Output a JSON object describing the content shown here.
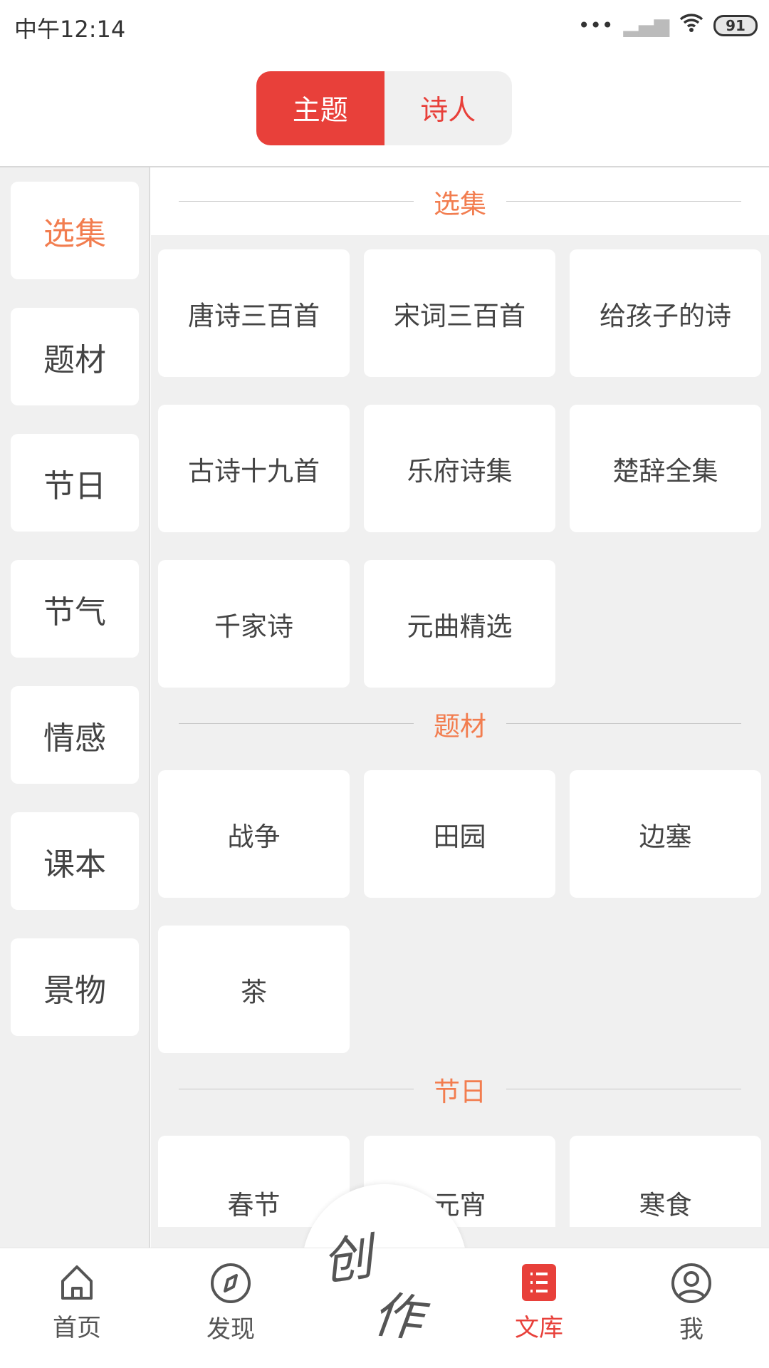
{
  "status": {
    "time": "中午12:14",
    "battery": "91",
    "icons": [
      "more-dots-icon",
      "signal-icon",
      "wifi-icon",
      "battery-icon"
    ]
  },
  "segment": {
    "tabs": [
      {
        "label": "主题",
        "active": true
      },
      {
        "label": "诗人",
        "active": false
      }
    ]
  },
  "sidebar": {
    "items": [
      {
        "label": "选集",
        "active": true
      },
      {
        "label": "题材"
      },
      {
        "label": "节日"
      },
      {
        "label": "节气"
      },
      {
        "label": "情感"
      },
      {
        "label": "课本"
      },
      {
        "label": "景物"
      }
    ]
  },
  "sections": [
    {
      "title": "选集",
      "items": [
        "唐诗三百首",
        "宋词三百首",
        "给孩子的诗",
        "古诗十九首",
        "乐府诗集",
        "楚辞全集",
        "千家诗",
        "元曲精选"
      ]
    },
    {
      "title": "题材",
      "items": [
        "战争",
        "田园",
        "边塞",
        "茶"
      ]
    },
    {
      "title": "节日",
      "items": [
        "春节",
        "元宵",
        "寒食"
      ]
    }
  ],
  "nav": {
    "tabs": [
      {
        "label": "首页",
        "icon": "home-icon"
      },
      {
        "label": "发现",
        "icon": "compass-icon"
      },
      {
        "label": "文库",
        "icon": "list-icon",
        "active": true
      },
      {
        "label": "我",
        "icon": "user-icon"
      }
    ],
    "center": "创作"
  },
  "colors": {
    "accent": "#e8403a",
    "highlight": "#f27d4f"
  }
}
